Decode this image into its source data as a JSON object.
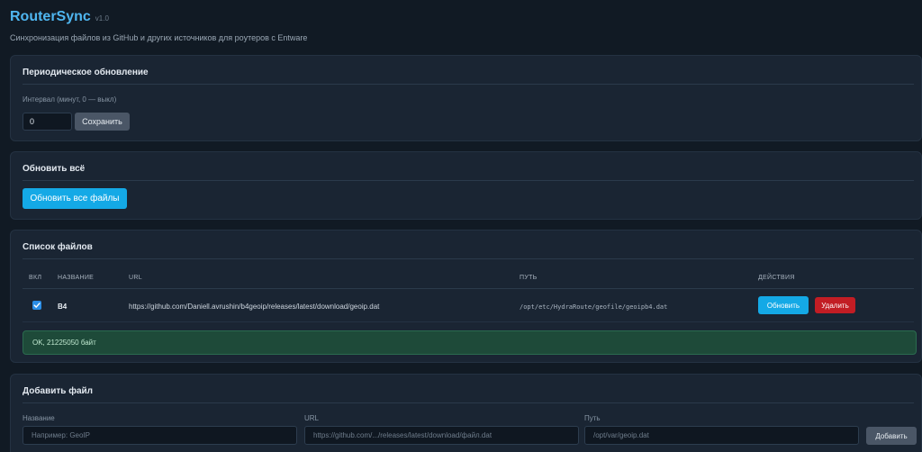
{
  "app": {
    "title": "RouterSync",
    "version": "v1.0",
    "subtitle": "Синхронизация файлов из GitHub и других источников для роутеров с Entware"
  },
  "periodic": {
    "title": "Периодическое обновление",
    "interval_label": "Интервал (минут, 0 — выкл)",
    "interval_value": "0",
    "save_label": "Сохранить"
  },
  "update_all": {
    "title": "Обновить всё",
    "button_label": "Обновить все файлы"
  },
  "files": {
    "title": "Список файлов",
    "columns": [
      "ВКЛ",
      "НАЗВАНИЕ",
      "URL",
      "ПУТЬ",
      "ДЕЙСТВИЯ"
    ],
    "rows": [
      {
        "enabled": true,
        "name": "B4",
        "url": "https://github.com/Daniell.avrushin/b4geoip/releases/latest/download/geoip.dat",
        "path": "/opt/etc/HydraRoute/geofile/geoipb4.dat",
        "update_label": "Обновить",
        "delete_label": "Удалить"
      }
    ],
    "status": "OK, 21225050 байт"
  },
  "add_file": {
    "title": "Добавить файл",
    "name_label": "Название",
    "name_placeholder": "Например: GeoIP",
    "url_label": "URL",
    "url_placeholder": "https://github.com/.../releases/latest/download/файл.dat",
    "path_label": "Путь",
    "path_placeholder": "/opt/var/geoip.dat",
    "add_label": "Добавить"
  },
  "colors": {
    "background": "#111a24",
    "card": "#1a2533",
    "accent": "#14a9e6",
    "title": "#4fb6f0",
    "danger": "#c21d24",
    "success_bg": "#1e4a39"
  },
  "icons": {
    "checkbox": "check-icon"
  }
}
